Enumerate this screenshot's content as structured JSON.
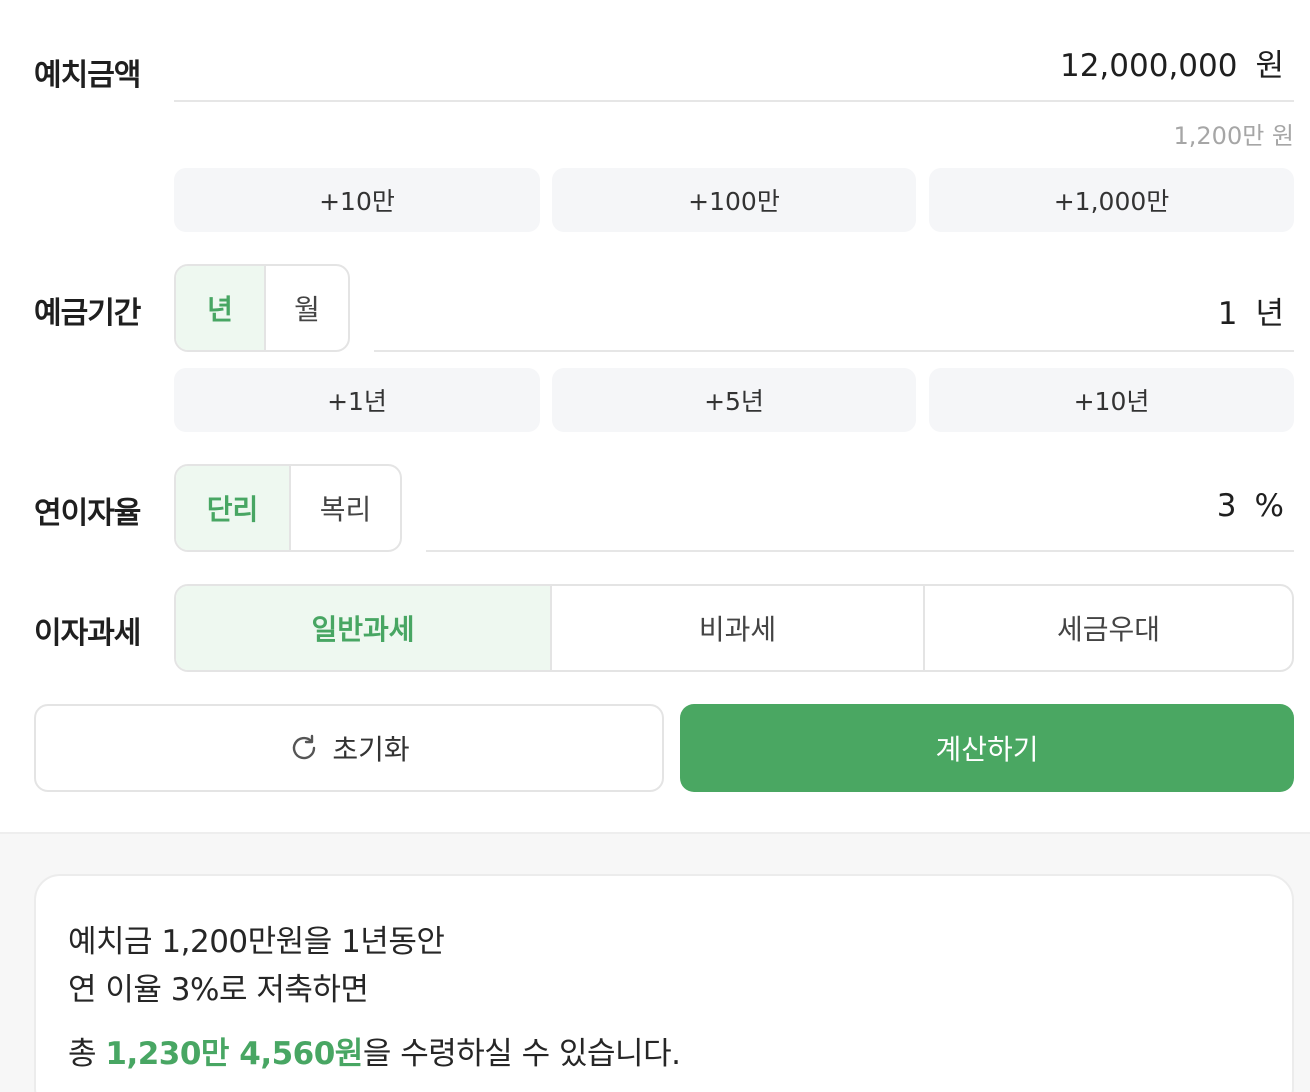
{
  "deposit": {
    "label": "예치금액",
    "value": "12,000,000",
    "unit": "원",
    "helper": "1,200만 원",
    "quick_buttons": [
      "+10만",
      "+100만",
      "+1,000만"
    ]
  },
  "period": {
    "label": "예금기간",
    "unit_options": [
      "년",
      "월"
    ],
    "selected_unit": "년",
    "value": "1",
    "unit": "년",
    "quick_buttons": [
      "+1년",
      "+5년",
      "+10년"
    ]
  },
  "rate": {
    "label": "연이자율",
    "type_options": [
      "단리",
      "복리"
    ],
    "selected_type": "단리",
    "value": "3",
    "unit": "%"
  },
  "tax": {
    "label": "이자과세",
    "options": [
      "일반과세",
      "비과세",
      "세금우대"
    ],
    "selected": "일반과세"
  },
  "actions": {
    "reset_label": "초기화",
    "reset_icon": "refresh-icon",
    "calculate_label": "계산하기"
  },
  "result": {
    "line1": "예치금 1,200만원을 1년동안",
    "line2": "연 이율 3%로 저축하면",
    "line3_prefix": "총 ",
    "line3_amount": "1,230만 4,560원",
    "line3_suffix": "을 수령하실 수 있습니다."
  },
  "colors": {
    "accent": "#48a663",
    "accent_bg": "#eef8f0",
    "button_bg": "#f5f6f8",
    "primary_button": "#4aa762"
  }
}
